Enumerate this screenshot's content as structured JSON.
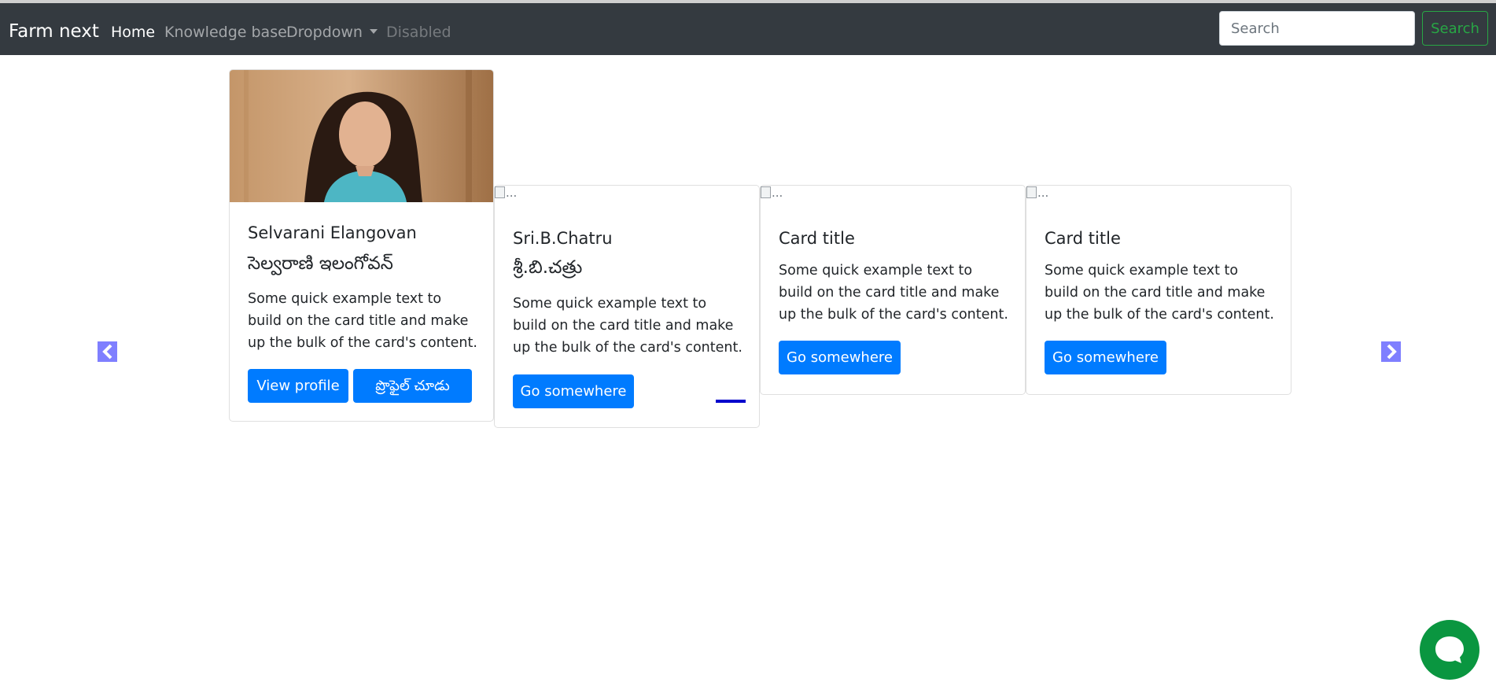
{
  "navbar": {
    "brand": "Farm next",
    "items": [
      {
        "label": "Home"
      },
      {
        "label": "Knowledge base"
      },
      {
        "label": "Dropdown"
      },
      {
        "label": "Disabled"
      }
    ],
    "search": {
      "placeholder": "Search",
      "button_label": "Search"
    }
  },
  "cards": [
    {
      "title": "Selvarani Elangovan",
      "subtitle": "సెల్వరాణి ఇలంగోవన్",
      "text": "Some quick example text to build on the card title and make up the bulk of the card's content.",
      "buttons": [
        "View profile",
        "ప్రొఫైల్ చూడు"
      ]
    },
    {
      "image_alt": "...",
      "title": "Sri.B.Chatru",
      "subtitle": "శ్రీ.బి.చత్రు",
      "text": "Some quick example text to build on the card title and make up the bulk of the card's content.",
      "button": "Go somewhere"
    },
    {
      "image_alt": "...",
      "title": "Card title",
      "text": "Some quick example text to build on the card title and make up the bulk of the card's content.",
      "button": "Go somewhere"
    },
    {
      "image_alt": "...",
      "title": "Card title",
      "text": "Some quick example text to build on the card title and make up the bulk of the card's content.",
      "button": "Go somewhere"
    }
  ],
  "carousel": {
    "prev_icon": "chevron-left-icon",
    "next_icon": "chevron-right-icon"
  },
  "chat": {
    "icon": "chat-bubble-icon"
  },
  "colors": {
    "navbar_bg": "#343a40",
    "primary": "#007bff",
    "success": "#28a745",
    "arrow": "#7f7fff",
    "chat": "#0a9640",
    "indicator": "#0000cc"
  }
}
